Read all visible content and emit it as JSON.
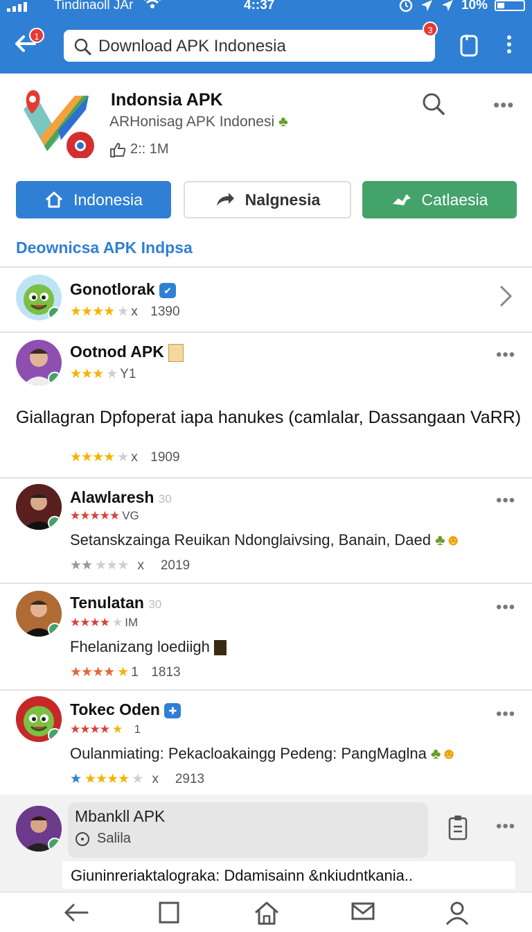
{
  "status": {
    "carrier": "Tindinaoll JAr",
    "time": "4::37",
    "battery": "10%"
  },
  "appbar": {
    "back_badge": "1",
    "search_query": "Download APK Indonesia",
    "search_badge": "3"
  },
  "app": {
    "title": "Indonsia APK",
    "subtitle": "ARHonisag APK Indonesi",
    "meta": "2:: 1M"
  },
  "buttons": {
    "primary": "Indonesia",
    "secondary": "Nalgnesia",
    "tertiary": "Catlaesia"
  },
  "section_title": "Deownicsa APK Indpsa",
  "items": [
    {
      "name": "Gonotlorak",
      "rating_suffix": "x",
      "count": "1390"
    },
    {
      "name": "Ootnod APK",
      "rating_suffix": "Y1",
      "count": ""
    },
    {
      "desc": "Giallagran Dpfoperat iapa hanukes (camlalar, Dassangaan VaRR)",
      "rating_suffix": "x",
      "count": "1909"
    },
    {
      "name": "Alawlaresh",
      "tag": "30",
      "rating_suffix": "VG",
      "desc": "Setanskzainga Reuikan Ndonglaivsing, Banain, Daed",
      "count": "2019",
      "count_prefix": "x"
    },
    {
      "name": "Tenulatan",
      "tag": "30",
      "rating_suffix": "IM",
      "desc": "Fhelanizang loediigh",
      "count": "1813",
      "count_prefix": "1"
    },
    {
      "name": "Tokec Oden",
      "rating_suffix": "1",
      "desc": "Oulanmiating: Pekacloakaingg Pedeng: PangMaglna",
      "count": "2913",
      "count_prefix": "x"
    }
  ],
  "bottom": {
    "name": "Mbankll APK",
    "sub": "Salila",
    "desc": "Giuninreriaktalograka: Ddamisainn &nkiudntkania.."
  },
  "colors": {
    "primary": "#2f7fd4",
    "green": "#43a36a",
    "star": "#f5b400",
    "star_red": "#d8423a"
  }
}
